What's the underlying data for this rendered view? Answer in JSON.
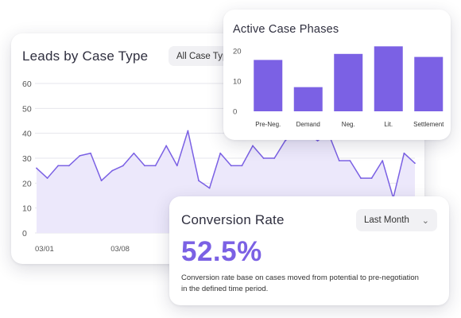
{
  "leads": {
    "title": "Leads by Case Type",
    "dropdown_value": "All Case Types"
  },
  "phases": {
    "title": "Active Case Phases"
  },
  "conversion": {
    "title": "Conversion Rate",
    "dropdown_value": "Last Month",
    "value": "52.5%",
    "description": "Conversion rate base on cases moved from potential to pre-negotiation in the defined time period."
  },
  "colors": {
    "accent": "#7b61e4",
    "area_fill": "#ece8fb",
    "grid": "#e6e6ec"
  },
  "chart_data": [
    {
      "type": "area",
      "title": "Leads by Case Type",
      "ylim": [
        0,
        60
      ],
      "yticks": [
        0,
        10,
        20,
        30,
        40,
        50,
        60
      ],
      "xticks": [
        {
          "index": 0,
          "label": "03/01"
        },
        {
          "index": 7,
          "label": "03/08"
        }
      ],
      "grid": true,
      "series": [
        {
          "values": [
            26,
            22,
            27,
            27,
            31,
            32,
            21,
            25,
            27,
            32,
            27,
            27,
            35,
            27,
            41,
            21,
            18,
            32,
            27,
            27,
            35,
            30,
            30,
            37,
            41,
            40,
            37,
            40,
            29,
            29,
            22,
            22,
            29,
            14,
            32,
            28
          ]
        }
      ]
    },
    {
      "type": "bar",
      "title": "Active Case Phases",
      "categories": [
        "Pre-Neg.",
        "Demand",
        "Neg.",
        "Lit.",
        "Settlement"
      ],
      "values": [
        17,
        8,
        19,
        21.5,
        18
      ],
      "ylim": [
        0,
        20
      ],
      "yticks": [
        0,
        10,
        20
      ],
      "grid": false
    }
  ]
}
